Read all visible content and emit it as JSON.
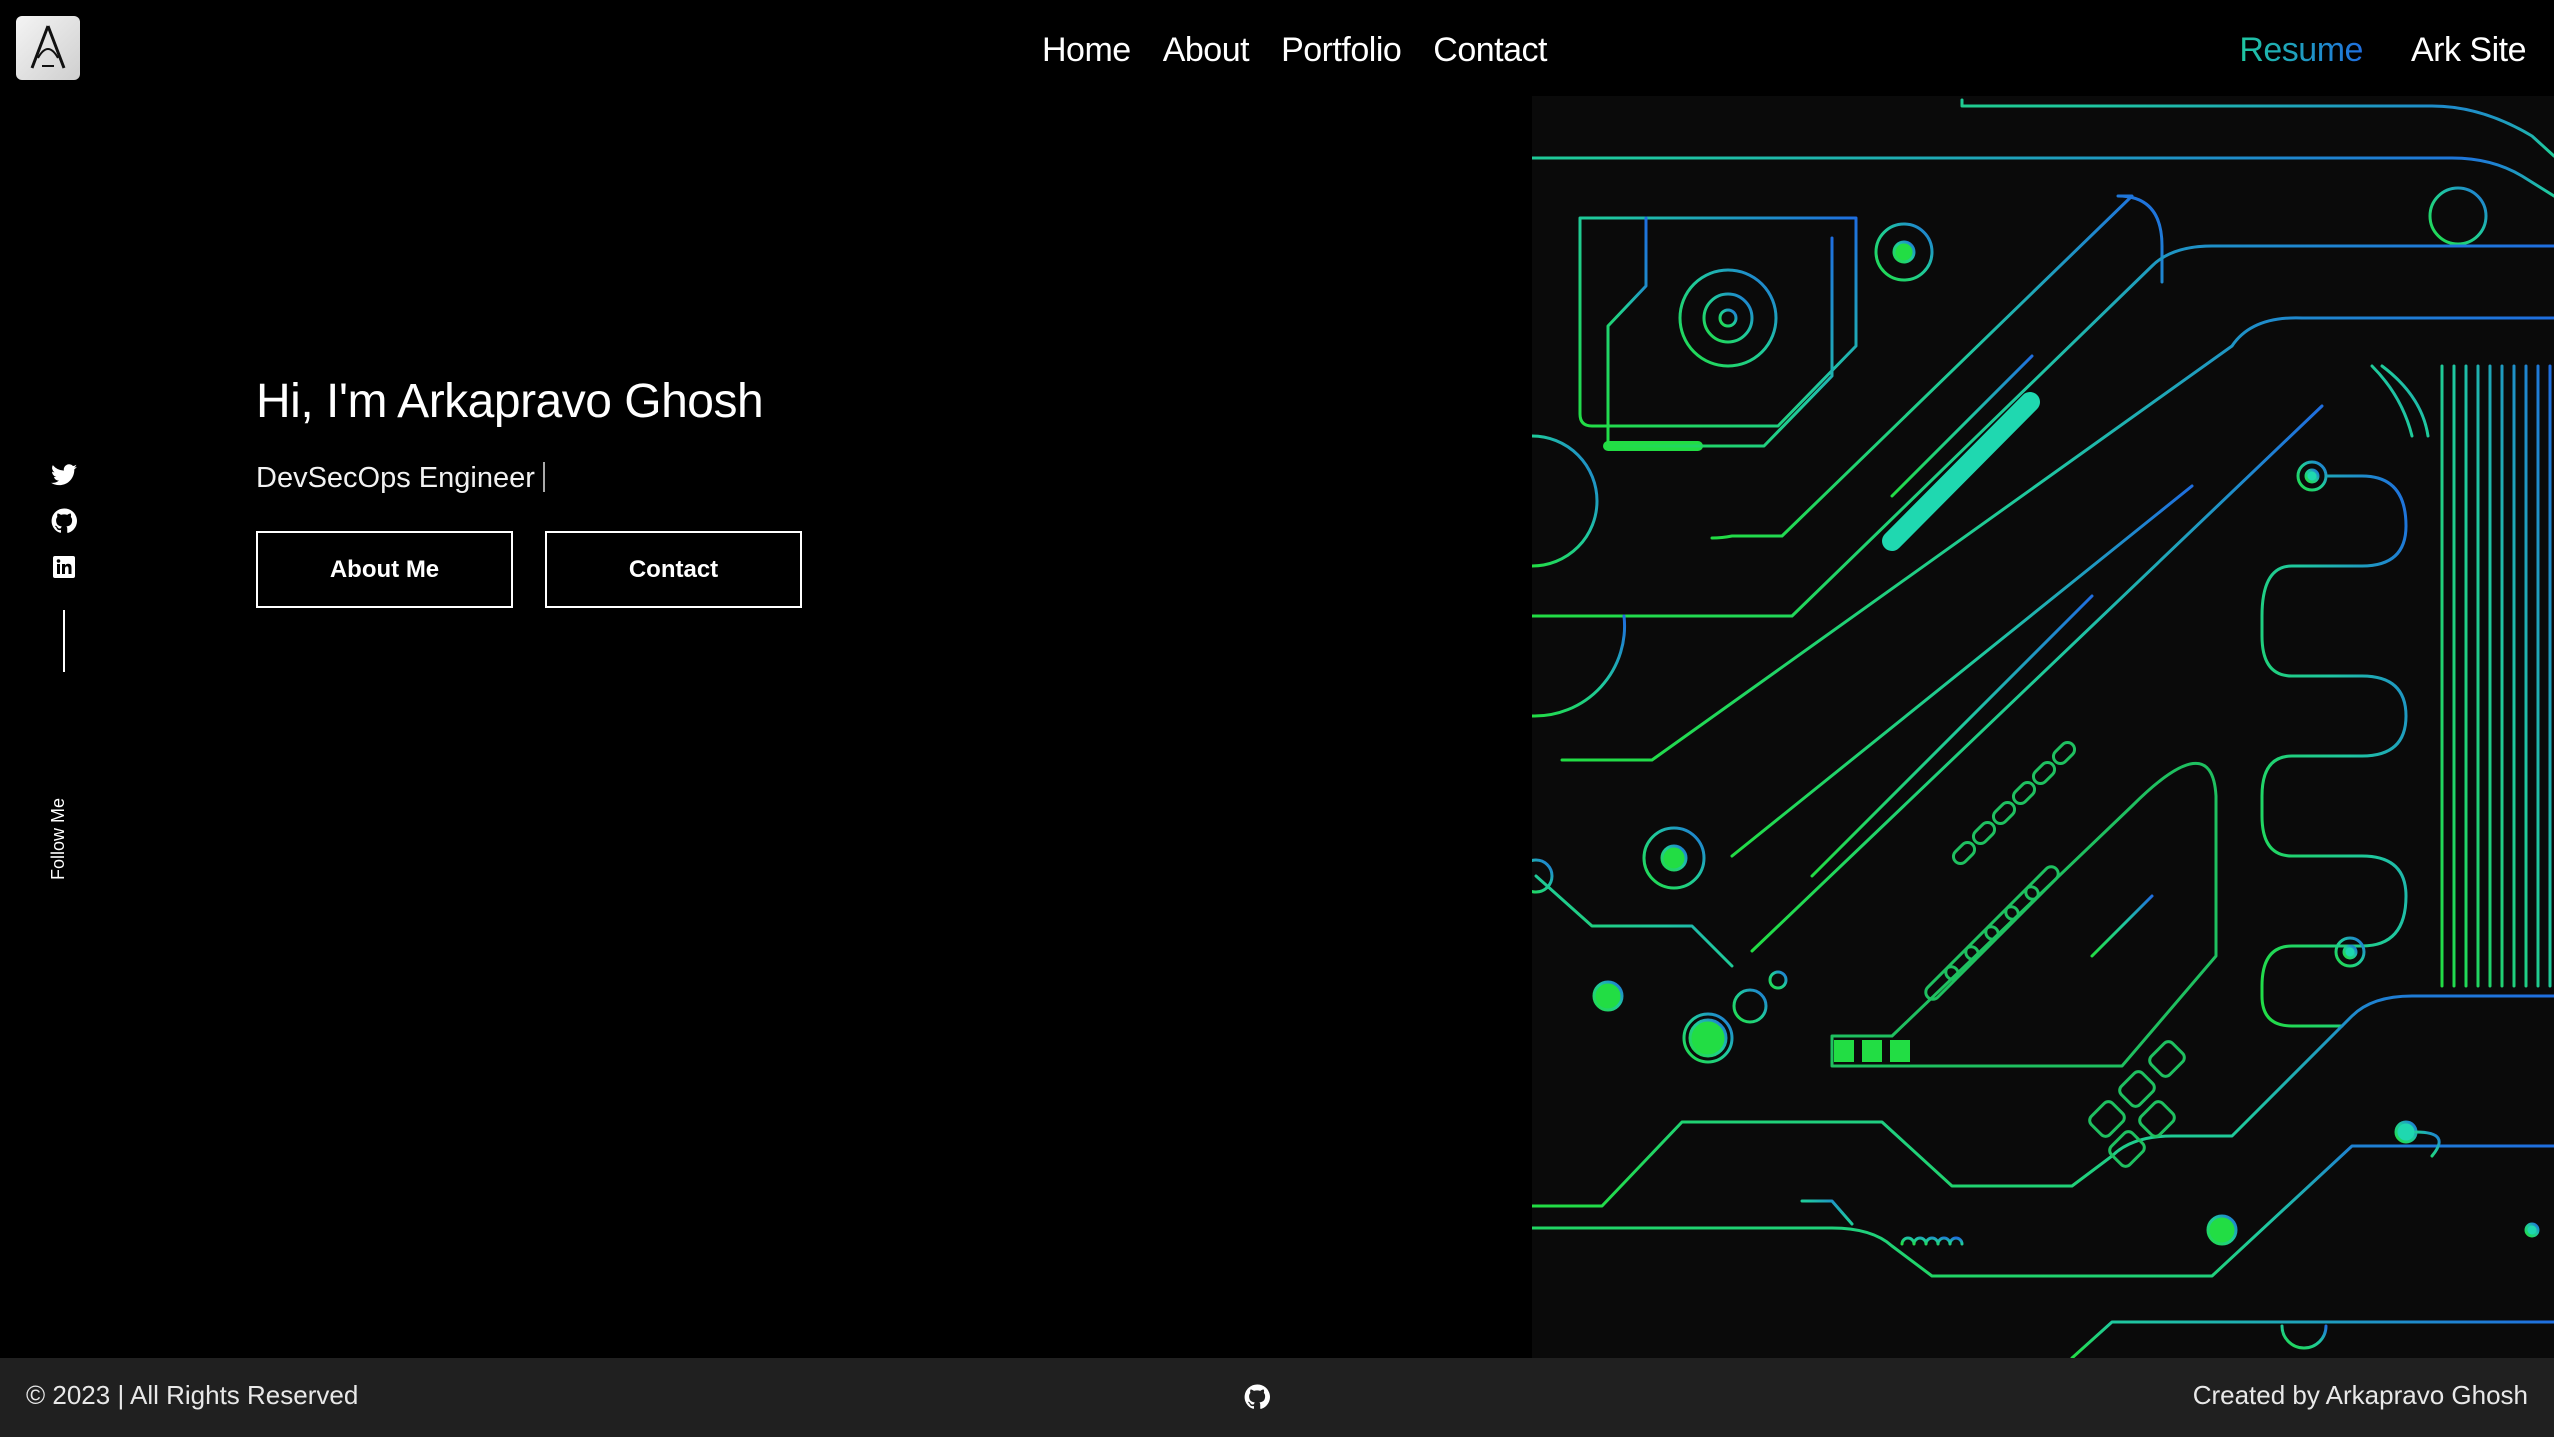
{
  "header": {
    "nav": [
      "Home",
      "About",
      "Portfolio",
      "Contact"
    ],
    "resume_label": "Resume",
    "site_label": "Ark Site",
    "logo_icon": "ark-logo-icon"
  },
  "hero": {
    "title": "Hi, I'm Arkapravo Ghosh",
    "subtitle": "DevSecOps Engineer",
    "buttons": {
      "about": "About Me",
      "contact": "Contact"
    },
    "follow_label": "Follow Me",
    "social_icons": [
      "twitter-icon",
      "github-icon",
      "linkedin-icon"
    ]
  },
  "footer": {
    "copyright": "© 2023 | All Rights Reserved",
    "credit": "Created by Arkapravo Ghosh",
    "center_icon": "github-icon"
  },
  "colors": {
    "background": "#000000",
    "footer_bg": "#202020",
    "accent_green": "#22dd44",
    "accent_teal": "#1fc8a0",
    "accent_blue": "#1f6ee0"
  }
}
